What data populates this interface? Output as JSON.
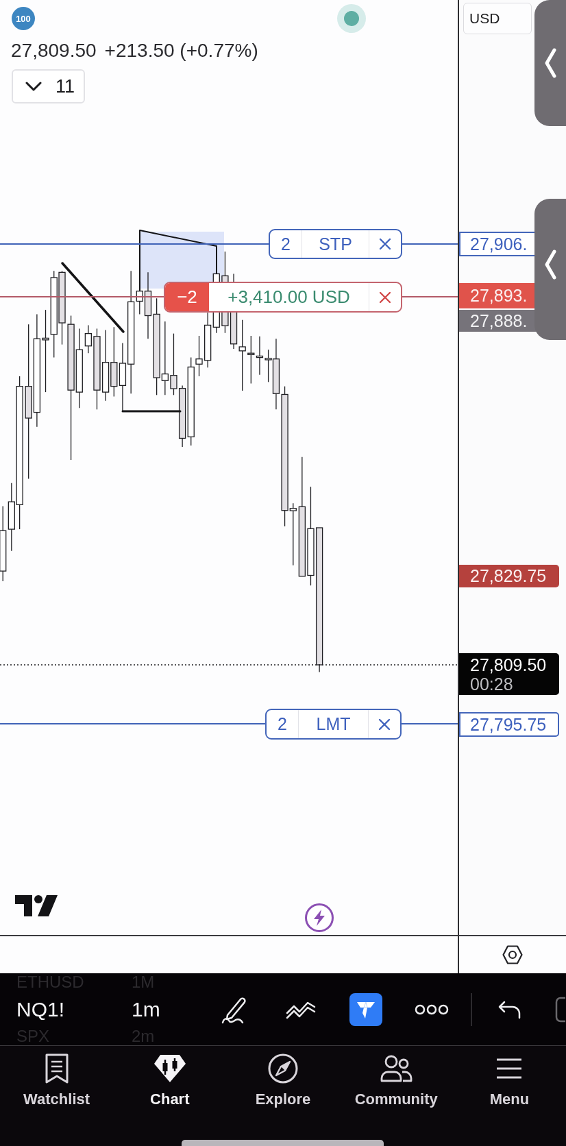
{
  "header": {
    "badge": "100",
    "last_price": "27,809.50",
    "change": "+213.50 (+0.77%)",
    "dropdown": "11",
    "currency": "USD"
  },
  "chart_lines": [
    {
      "kind": "order",
      "qty": "2",
      "label": "STP",
      "price": "27,906."
    },
    {
      "kind": "position",
      "qty": "−2",
      "label": "+3,410.00 USD",
      "price": "27,893."
    },
    {
      "kind": "order",
      "qty": "2",
      "label": "LMT",
      "price": "27,795.75"
    }
  ],
  "price_scale": [
    {
      "kind": "marker",
      "price": "27,888."
    },
    {
      "kind": "alert",
      "price": "27,829.75"
    },
    {
      "kind": "last",
      "price": "27,809.50",
      "countdown": "00:28"
    }
  ],
  "toolbar": {
    "symbol_picker": [
      {
        "symbol": "ETHUSD",
        "interval": "1M",
        "selected": false
      },
      {
        "symbol": "NQ1!",
        "interval": "1m",
        "selected": true
      },
      {
        "symbol": "SPX",
        "interval": "2m",
        "selected": false
      }
    ]
  },
  "nav": [
    {
      "label": "Watchlist",
      "selected": false
    },
    {
      "label": "Chart",
      "selected": true
    },
    {
      "label": "Explore",
      "selected": false
    },
    {
      "label": "Community",
      "selected": false
    },
    {
      "label": "Menu",
      "selected": false
    }
  ]
}
